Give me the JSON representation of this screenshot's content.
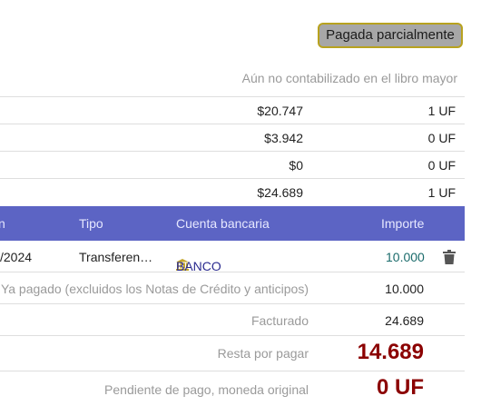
{
  "status": {
    "badge": "Pagada parcialmente",
    "ledger_note": "Aún no contabilizado en el libro mayor"
  },
  "totals": [
    {
      "amount": "$20.747",
      "uf": "1 UF"
    },
    {
      "amount": "$3.942",
      "uf": "0 UF"
    },
    {
      "amount": "$0",
      "uf": "0 UF"
    },
    {
      "amount": "$24.689",
      "uf": "1 UF"
    }
  ],
  "payments": {
    "headers": {
      "date": "n",
      "type": "Tipo",
      "bank_account": "Cuenta bancaria",
      "amount": "Importe"
    },
    "rows": [
      {
        "date": "/2024",
        "type": "Transferen…",
        "bank_icon": "bank-icon",
        "bank": "BANCO",
        "amount": "10.000",
        "delete_icon": "trash-icon"
      }
    ]
  },
  "summary": {
    "already_paid_label": "Ya pagado (excluidos los Notas de Crédito y anticipos)",
    "already_paid_value": "10.000",
    "invoiced_label": "Facturado",
    "invoiced_value": "24.689",
    "remaining_label": "Resta por pagar",
    "remaining_value": "14.689",
    "pending_label": "Pendiente de pago, moneda original",
    "pending_value": "0 UF"
  },
  "colors": {
    "header_bg": "#5c64c4",
    "remaining": "#8b0000",
    "amount_link": "#1a6b6b",
    "badge_border": "#b8a21f"
  }
}
